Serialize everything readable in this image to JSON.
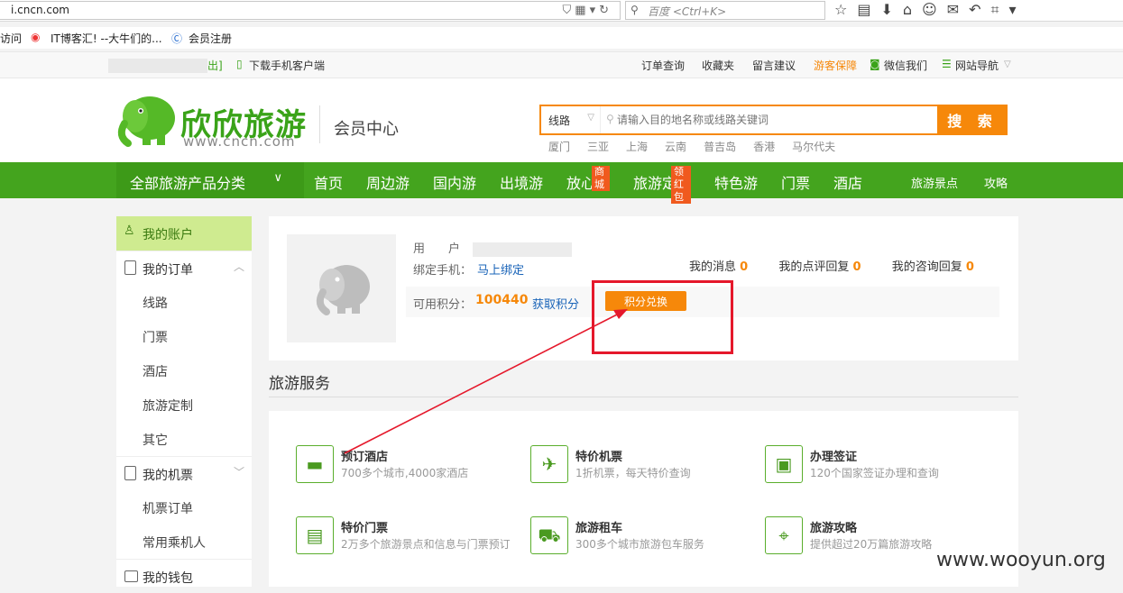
{
  "browser": {
    "url": "i.cncn.com",
    "search_placeholder": "百度 <Ctrl+K>",
    "bookmarks": [
      "访问",
      "IT博客汇! --大牛们的...",
      "会员注册"
    ]
  },
  "topbar": {
    "logout": "出]",
    "download_app": "下载手机客户端",
    "links": [
      "订单查询",
      "收藏夹",
      "留言建议",
      "游客保障",
      "微信我们",
      "网站导航"
    ],
    "guarantee_color": "#f6880a"
  },
  "header": {
    "logo_text": "欣欣旅游",
    "logo_domain": "www.cncn.com",
    "member_center": "会员中心",
    "search_type": "线路",
    "search_placeholder": "请输入目的地名称或线路关键词",
    "search_button": "搜 索",
    "hot_cities": [
      "厦门",
      "三亚",
      "上海",
      "云南",
      "普吉岛",
      "香港",
      "马尔代夫"
    ]
  },
  "nav": {
    "category": "全部旅游产品分类",
    "items": [
      "首页",
      "周边游",
      "国内游",
      "出境游",
      "放心游",
      "旅游定制",
      "特色游",
      "门票",
      "酒店"
    ],
    "small_items": [
      "旅游景点",
      "攻略"
    ],
    "badges": {
      "mall": "商城",
      "red_packet": "领红包"
    }
  },
  "sidebar": {
    "account": "我的账户",
    "orders": "我的订单",
    "order_items": [
      "线路",
      "门票",
      "酒店",
      "旅游定制",
      "其它"
    ],
    "flights": "我的机票",
    "flight_items": [
      "机票订单",
      "常用乘机人"
    ],
    "wallet": "我的钱包"
  },
  "profile": {
    "user_label": "用　　户",
    "phone_label": "绑定手机：",
    "bind_link": "马上绑定",
    "messages": {
      "label": "我的消息",
      "count": "0"
    },
    "reviews": {
      "label": "我的点评回复",
      "count": "0"
    },
    "consult": {
      "label": "我的咨询回复",
      "count": "0"
    },
    "points_label": "可用积分：",
    "points_value": "100440",
    "get_points": "获取积分",
    "exchange_button": "积分兑换"
  },
  "services": {
    "title": "旅游服务",
    "items": [
      {
        "title": "预订酒店",
        "desc": "700多个城市,4000家酒店",
        "icon": "bed-icon"
      },
      {
        "title": "特价机票",
        "desc": "1折机票，每天特价查询",
        "icon": "ticket-icon"
      },
      {
        "title": "办理签证",
        "desc": "120个国家签证办理和查询",
        "icon": "visa-icon"
      },
      {
        "title": "特价门票",
        "desc": "2万多个旅游景点和信息与门票预订",
        "icon": "gate-ticket-icon"
      },
      {
        "title": "旅游租车",
        "desc": "300多个城市旅游包车服务",
        "icon": "car-icon"
      },
      {
        "title": "旅游攻略",
        "desc": "提供超过20万篇旅游攻略",
        "icon": "map-pin-icon"
      }
    ]
  },
  "watermark": "www.wooyun.org",
  "colors": {
    "brand_green": "#44a41e",
    "accent_orange": "#f6880a",
    "highlight_red": "#e5182b"
  }
}
